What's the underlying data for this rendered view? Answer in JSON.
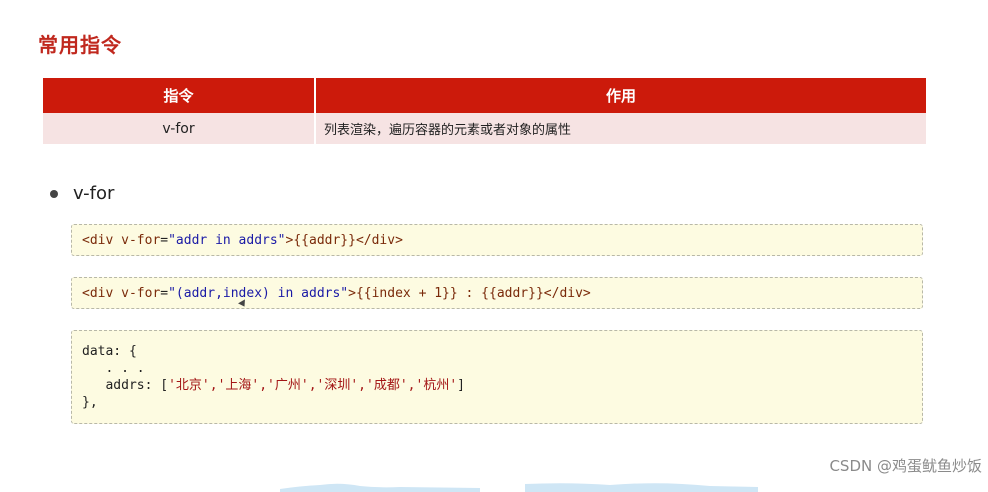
{
  "section_title": "常用指令",
  "table": {
    "headers": [
      "指令",
      "作用"
    ],
    "rows": [
      {
        "directive": "v-for",
        "purpose": "列表渲染，遍历容器的元素或者对象的属性"
      }
    ]
  },
  "bullet": "v-for",
  "code": {
    "example1": {
      "open": "<div ",
      "attr": "v-for",
      "eq": "=",
      "value": "\"addr in addrs\"",
      "rest": ">{{addr}}</div>"
    },
    "example2": {
      "open": "<div ",
      "attr": "v-for",
      "eq": "=",
      "value": "\"(addr,index) in addrs\"",
      "rest": ">{{index + 1}} : {{addr}}</div>"
    },
    "example3": {
      "line1": "data: {",
      "line2": "   . . .",
      "line3_prefix": "   addrs: [",
      "line3_values": "'北京','上海','广州','深圳','成都','杭州'",
      "line3_suffix": "]",
      "line4": "},"
    }
  },
  "watermark": "CSDN @鸡蛋鱿鱼炒饭",
  "colors": {
    "title": "#c0281e",
    "table_header": "#cc1a0b",
    "table_row": "#f6e3e3",
    "code_bg": "#fdfbe1"
  }
}
